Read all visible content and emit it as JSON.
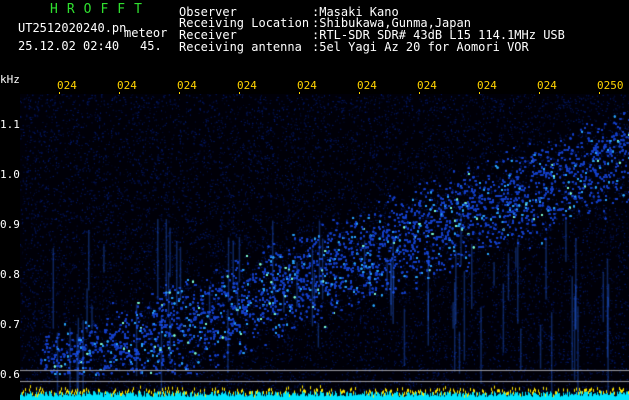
{
  "header": {
    "brand": "HROFFT",
    "file_name": "UT2512020240.pn",
    "meteor_label": "meteor",
    "datetime": "25.12.02 02:40",
    "count": "45.",
    "info": [
      {
        "key": "Observer",
        "value": ":Masaki Kano"
      },
      {
        "key": "Receiving Location",
        "value": ":Shibukawa,Gunma,Japan"
      },
      {
        "key": "Receiver",
        "value": ":RTL-SDR SDR# 43dB L15 114.1MHz USB"
      },
      {
        "key": "Receiving antenna",
        "value": ":5el Yagi Az 20 for Aomori VOR"
      }
    ]
  },
  "axis": {
    "unit": "kHz",
    "y_ticks": [
      "1.1",
      "1.0",
      "0.9",
      "0.8",
      "0.7",
      "0.6"
    ],
    "x_ticks": [
      "024",
      "024",
      "024",
      "024",
      "024",
      "024",
      "024",
      "024",
      "024",
      "0250"
    ]
  },
  "colors": {
    "background": "#000000",
    "tick_yellow": "#ffd400",
    "brand_green": "#2fe02f",
    "noise_cyan": "#00e6ff"
  }
}
